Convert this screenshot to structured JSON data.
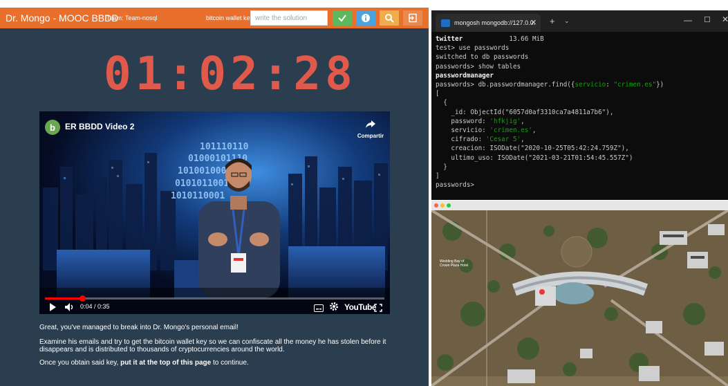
{
  "app": {
    "title": "Dr. Mongo - MOOC BBDD",
    "team": "Team: Team-nosql",
    "wallet_label": "bitcoin wallet key",
    "solution_placeholder": "write the solution",
    "colors": {
      "topbar": "#e8702c",
      "background": "#2b3e4f",
      "timer": "#e05a4c",
      "check": "#5cb85c",
      "info": "#4aa3df",
      "search": "#f0ad4e"
    },
    "icons": [
      "check-icon",
      "info-icon",
      "search-icon",
      "exit-icon"
    ]
  },
  "timer": "01:02:28",
  "video": {
    "channel_initial": "b",
    "title": "ER BBDD Video 2",
    "share_label": "Compartir",
    "time": "0:04 / 0:35",
    "progress": 0.11,
    "youtube_label": "YouTube"
  },
  "message": {
    "line1": "Great, you've managed to break into Dr. Mongo's personal email!",
    "line2": "Examine his emails and try to get the bitcoin wallet key so we can confiscate all the money he has stolen before it disappears and is distributed to thousands of cryptocurrencies around the world.",
    "line3_prefix": "Once you obtain said key, ",
    "line3_bold": "put it at the top of this page",
    "line3_suffix": " to continue."
  },
  "terminal": {
    "tab_title": "mongosh mongodb://127.0.0.",
    "line_twitter_name": "twitter",
    "line_twitter_size": "13.66 MiB",
    "cmd_use": "test> use passwords",
    "switched": "switched to db passwords",
    "cmd_show": "passwords> show tables",
    "table_name": "passwordmanager",
    "cmd_find_prefix": "passwords> db.passwordmanager.find({",
    "cmd_find_key": "servicio",
    "cmd_find_mid": ": ",
    "cmd_find_value": "\"crimen.es\"",
    "cmd_find_suffix": "})",
    "open_bracket": "[",
    "open_brace": "  {",
    "id_line": "    _id: ObjectId(\"6057d0af3310ca7a4811a7b6\"),",
    "password_key": "    password: ",
    "password_value": "'hfkjig'",
    "servicio_key": "    servicio: ",
    "servicio_value": "'crimen.es'",
    "cifrado_key": "    cifrado: ",
    "cifrado_value": "'Cesar 5'",
    "creacion_line": "    creacion: ISODate(\"2020-10-25T05:42:24.759Z\"),",
    "ultimo_line": "    ultimo_uso: ISODate(\"2021-03-21T01:54:45.557Z\")",
    "close_brace": "  }",
    "close_bracket": "]",
    "prompt": "passwords>"
  },
  "map": {
    "label": "Wedding Bay of\nCrown Plaza Hotel"
  }
}
